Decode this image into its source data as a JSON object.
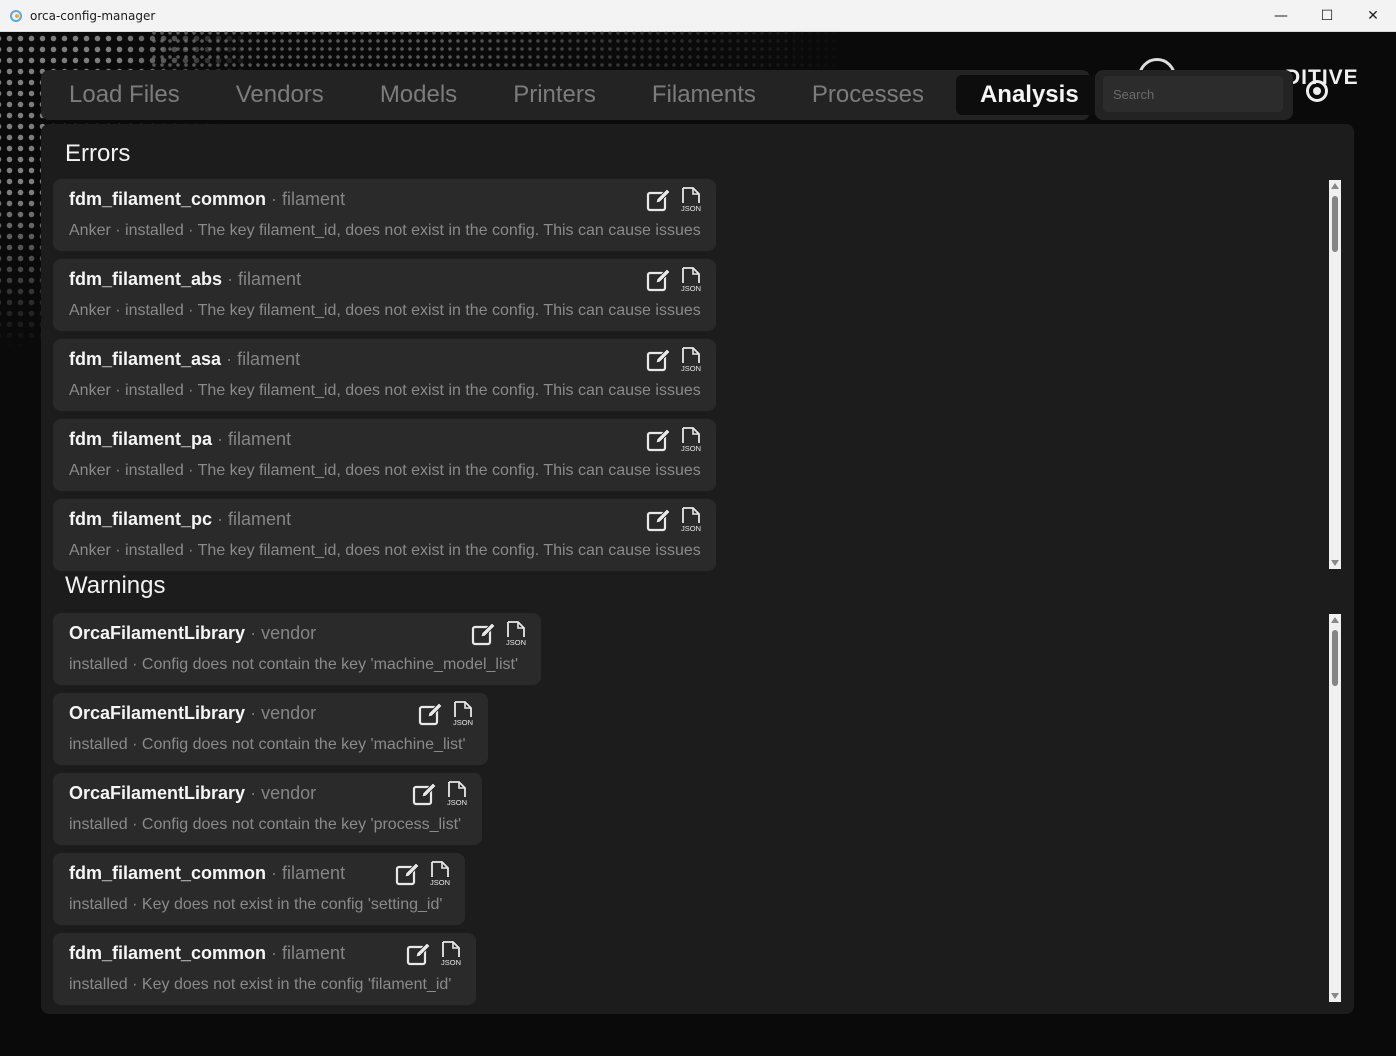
{
  "window": {
    "title": "orca-config-manager",
    "minimize_glyph": "—",
    "maximize_glyph": "☐",
    "close_glyph": "✕"
  },
  "logo": {
    "text": "DITIVE"
  },
  "tabs": [
    {
      "label": "Load Files",
      "active": false
    },
    {
      "label": "Vendors",
      "active": false
    },
    {
      "label": "Models",
      "active": false
    },
    {
      "label": "Printers",
      "active": false
    },
    {
      "label": "Filaments",
      "active": false
    },
    {
      "label": "Processes",
      "active": false
    },
    {
      "label": "Analysis",
      "active": true
    }
  ],
  "search": {
    "placeholder": "Search",
    "value": ""
  },
  "errors": {
    "title": "Errors",
    "items": [
      {
        "name": "fdm_filament_common",
        "kind": "filament",
        "detail": "Anker · installed · The key filament_id, does not exist in the config. This can cause issues"
      },
      {
        "name": "fdm_filament_abs",
        "kind": "filament",
        "detail": "Anker · installed · The key filament_id, does not exist in the config. This can cause issues"
      },
      {
        "name": "fdm_filament_asa",
        "kind": "filament",
        "detail": "Anker · installed · The key filament_id, does not exist in the config. This can cause issues"
      },
      {
        "name": "fdm_filament_pa",
        "kind": "filament",
        "detail": "Anker · installed · The key filament_id, does not exist in the config. This can cause issues"
      },
      {
        "name": "fdm_filament_pc",
        "kind": "filament",
        "detail": "Anker · installed · The key filament_id, does not exist in the config. This can cause issues"
      }
    ]
  },
  "warnings": {
    "title": "Warnings",
    "items": [
      {
        "name": "OrcaFilamentLibrary",
        "kind": "vendor",
        "detail": "installed · Config does not contain the key 'machine_model_list'"
      },
      {
        "name": "OrcaFilamentLibrary",
        "kind": "vendor",
        "detail": "installed · Config does not contain the key 'machine_list'"
      },
      {
        "name": "OrcaFilamentLibrary",
        "kind": "vendor",
        "detail": "installed · Config does not contain the key 'process_list'"
      },
      {
        "name": "fdm_filament_common",
        "kind": "filament",
        "detail": "installed · Key does not exist in the config 'setting_id'"
      },
      {
        "name": "fdm_filament_common",
        "kind": "filament",
        "detail": "installed · Key does not exist in the config 'filament_id'"
      }
    ]
  },
  "separator": " · ",
  "json_label": "JSON"
}
